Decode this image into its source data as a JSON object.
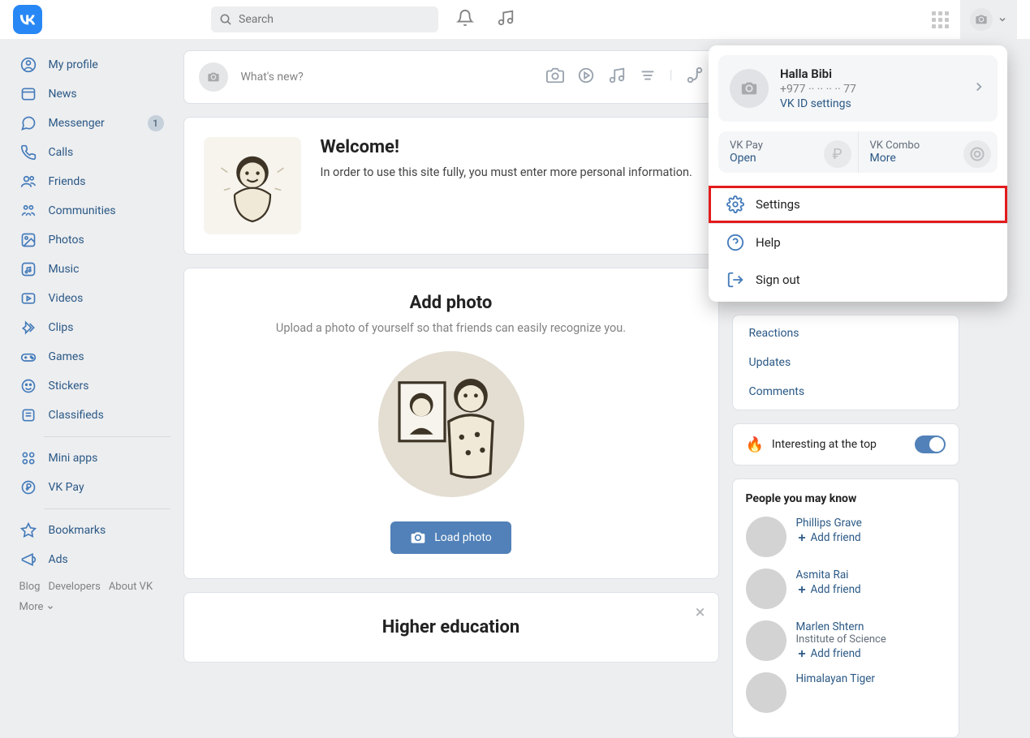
{
  "header": {
    "search_placeholder": "Search"
  },
  "sidebar": {
    "items": [
      {
        "label": "My profile"
      },
      {
        "label": "News"
      },
      {
        "label": "Messenger",
        "badge": "1"
      },
      {
        "label": "Calls"
      },
      {
        "label": "Friends"
      },
      {
        "label": "Communities"
      },
      {
        "label": "Photos"
      },
      {
        "label": "Music"
      },
      {
        "label": "Videos"
      },
      {
        "label": "Clips"
      },
      {
        "label": "Games"
      },
      {
        "label": "Stickers"
      },
      {
        "label": "Classifieds"
      }
    ],
    "items2": [
      {
        "label": "Mini apps"
      },
      {
        "label": "VK Pay"
      }
    ],
    "items3": [
      {
        "label": "Bookmarks"
      },
      {
        "label": "Ads"
      }
    ],
    "footer": {
      "blog": "Blog",
      "devs": "Developers",
      "about": "About VK",
      "more": "More"
    }
  },
  "post": {
    "placeholder": "What's new?"
  },
  "welcome": {
    "title": "Welcome!",
    "text": "In order to use this site fully, you must enter more personal information."
  },
  "addphoto": {
    "title": "Add photo",
    "text": "Upload a photo of yourself so that friends can easily recognize you.",
    "button": "Load photo"
  },
  "higher": {
    "title": "Higher education"
  },
  "filters": {
    "reactions": "Reactions",
    "updates": "Updates",
    "comments": "Comments"
  },
  "toggle": {
    "label": "Interesting at the top"
  },
  "pymk": {
    "title": "People you may know",
    "add": "Add friend",
    "people": [
      {
        "name": "Phillips Grave",
        "sub": ""
      },
      {
        "name": "Asmita Rai",
        "sub": ""
      },
      {
        "name": "Marlen Shtern",
        "sub": "Institute of Science"
      },
      {
        "name": "Himalayan Tiger",
        "sub": ""
      }
    ]
  },
  "dropdown": {
    "name": "Halla Bibi",
    "phone": "+977 ·· ·· ·· ·· 77",
    "vkid": "VK ID settings",
    "pay_title": "VK Pay",
    "pay_action": "Open",
    "combo_title": "VK Combo",
    "combo_action": "More",
    "settings": "Settings",
    "help": "Help",
    "signout": "Sign out"
  }
}
